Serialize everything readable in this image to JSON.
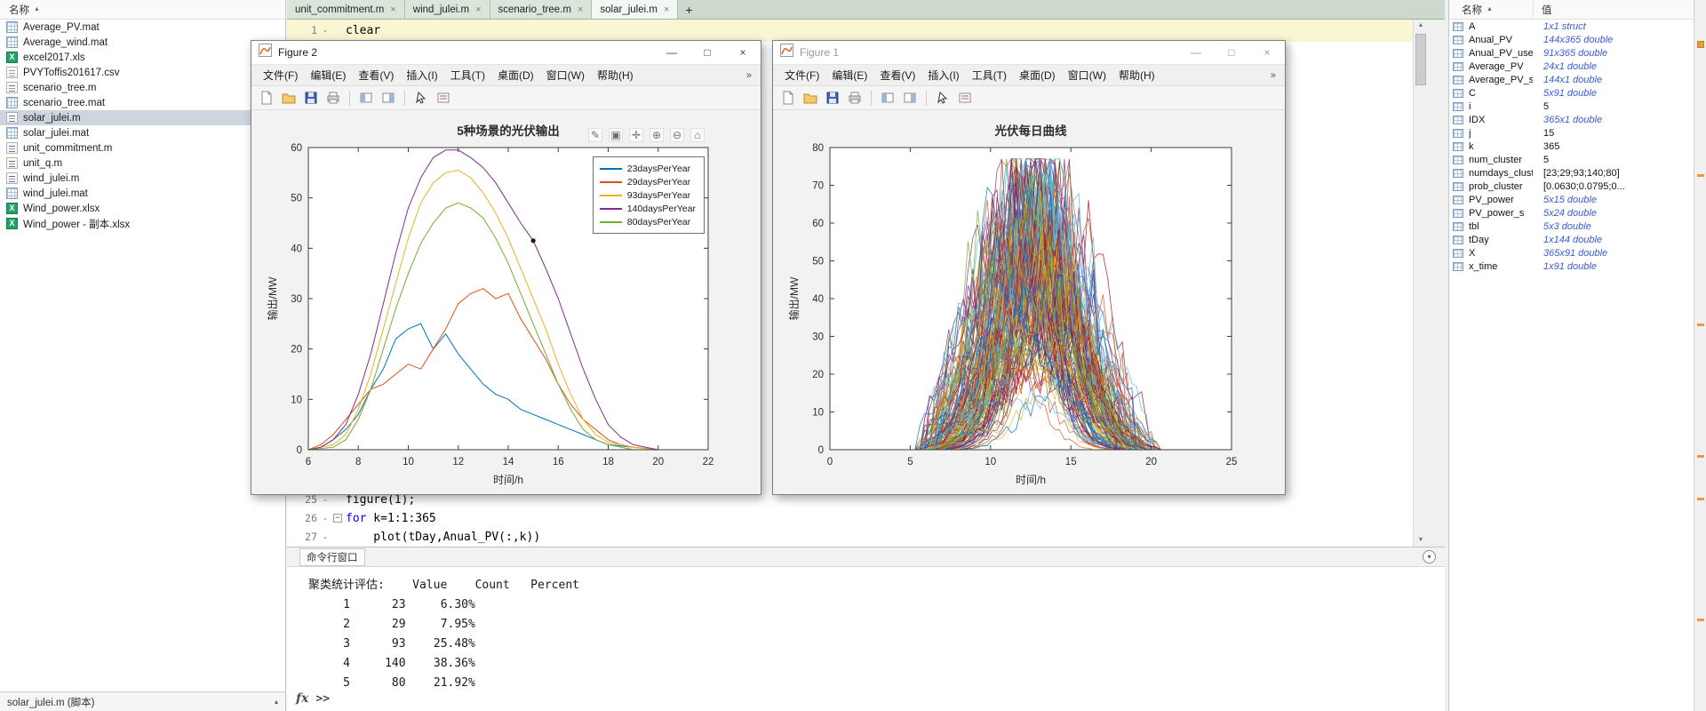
{
  "app": {
    "file_panel": {
      "header": "名称",
      "sort_arrow": "▲",
      "files": [
        {
          "name": "Average_PV.mat",
          "type": "mat",
          "selected": false
        },
        {
          "name": "Average_wind.mat",
          "type": "mat",
          "selected": false
        },
        {
          "name": "excel2017.xls",
          "type": "xls",
          "selected": false
        },
        {
          "name": "PVYToffis201617.csv",
          "type": "csv",
          "selected": false
        },
        {
          "name": "scenario_tree.m",
          "type": "m",
          "selected": false
        },
        {
          "name": "scenario_tree.mat",
          "type": "mat",
          "selected": false
        },
        {
          "name": "solar_julei.m",
          "type": "m",
          "selected": true
        },
        {
          "name": "solar_julei.mat",
          "type": "mat",
          "selected": false
        },
        {
          "name": "unit_commitment.m",
          "type": "m",
          "selected": false
        },
        {
          "name": "unit_q.m",
          "type": "m",
          "selected": false
        },
        {
          "name": "wind_julei.m",
          "type": "m",
          "selected": false
        },
        {
          "name": "wind_julei.mat",
          "type": "mat",
          "selected": false
        },
        {
          "name": "Wind_power.xlsx",
          "type": "xlsx",
          "selected": false
        },
        {
          "name": "Wind_power - 副本.xlsx",
          "type": "xlsx",
          "selected": false
        }
      ],
      "detail_label": "solar_julei.m (脚本)"
    },
    "editor": {
      "tabs": [
        {
          "label": "unit_commitment.m",
          "active": false
        },
        {
          "label": "wind_julei.m",
          "active": false
        },
        {
          "label": "scenario_tree.m",
          "active": false
        },
        {
          "label": "solar_julei.m",
          "active": true
        }
      ],
      "new_tab": "+",
      "lines_top": [
        {
          "num": "1",
          "marker": "-",
          "text": "clear"
        }
      ],
      "lines_bottom": [
        {
          "num": "25",
          "marker": "-",
          "text": "figure(1);"
        },
        {
          "num": "26",
          "marker": "-",
          "keyword": "for",
          "text": " k=1:1:365"
        },
        {
          "num": "27",
          "marker": "-",
          "text": "    plot(tDay,Anual_PV(:,k))"
        }
      ]
    },
    "command_window": {
      "title": "命令行窗口",
      "table": {
        "label": "聚类统计评估:",
        "headers": [
          "Value",
          "Count",
          "Percent"
        ],
        "rows": [
          [
            "1",
            "23",
            "6.30%"
          ],
          [
            "2",
            "29",
            "7.95%"
          ],
          [
            "3",
            "93",
            "25.48%"
          ],
          [
            "4",
            "140",
            "38.36%"
          ],
          [
            "5",
            "80",
            "21.92%"
          ]
        ]
      },
      "prompt_fx": "fx",
      "prompt": ">>"
    },
    "workspace": {
      "name_header": "名称",
      "sort_arrow": "▲",
      "value_header": "值",
      "vars": [
        {
          "name": "A",
          "value": "1x1 struct",
          "kind": "dim"
        },
        {
          "name": "Anual_PV",
          "value": "144x365 double",
          "kind": "dim"
        },
        {
          "name": "Anual_PV_useful",
          "value": "91x365 double",
          "kind": "dim"
        },
        {
          "name": "Average_PV",
          "value": "24x1 double",
          "kind": "dim"
        },
        {
          "name": "Average_PV_s",
          "value": "144x1 double",
          "kind": "dim"
        },
        {
          "name": "C",
          "value": "5x91 double",
          "kind": "dim"
        },
        {
          "name": "i",
          "value": "5",
          "kind": "num"
        },
        {
          "name": "IDX",
          "value": "365x1 double",
          "kind": "dim"
        },
        {
          "name": "j",
          "value": "15",
          "kind": "num"
        },
        {
          "name": "k",
          "value": "365",
          "kind": "num"
        },
        {
          "name": "num_cluster",
          "value": "5",
          "kind": "num"
        },
        {
          "name": "numdays_clust...",
          "value": "[23;29;93;140;80]",
          "kind": "num"
        },
        {
          "name": "prob_cluster",
          "value": "[0.0630;0.0795;0...",
          "kind": "num"
        },
        {
          "name": "PV_power",
          "value": "5x15 double",
          "kind": "dim"
        },
        {
          "name": "PV_power_s",
          "value": "5x24 double",
          "kind": "dim"
        },
        {
          "name": "tbl",
          "value": "5x3 double",
          "kind": "dim"
        },
        {
          "name": "tDay",
          "value": "1x144 double",
          "kind": "dim"
        },
        {
          "name": "X",
          "value": "365x91 double",
          "kind": "dim"
        },
        {
          "name": "x_time",
          "value": "1x91 double",
          "kind": "dim"
        }
      ]
    },
    "figure_windows": [
      {
        "title": "Figure 2",
        "active": true,
        "menu": [
          "文件(F)",
          "编辑(E)",
          "查看(V)",
          "插入(I)",
          "工具(T)",
          "桌面(D)",
          "窗口(W)",
          "帮助(H)"
        ],
        "window_buttons": [
          "—",
          "□",
          "×"
        ]
      },
      {
        "title": "Figure 1",
        "active": false,
        "menu": [
          "文件(F)",
          "编辑(E)",
          "查看(V)",
          "插入(I)",
          "工具(T)",
          "桌面(D)",
          "窗口(W)",
          "帮助(H)"
        ],
        "window_buttons": [
          "—",
          "□",
          "×"
        ]
      }
    ]
  },
  "chart_data": [
    {
      "figure": "Figure 2",
      "type": "line",
      "title": "5种场景的光伏输出",
      "xlabel": "时间/h",
      "ylabel": "输出/MW",
      "xlim": [
        6,
        22
      ],
      "ylim": [
        0,
        60
      ],
      "xticks": [
        6,
        8,
        10,
        12,
        14,
        16,
        18,
        20,
        22
      ],
      "yticks": [
        0,
        10,
        20,
        30,
        40,
        50,
        60
      ],
      "grid": false,
      "legend_position": "northeast",
      "marker_point": {
        "x": 15,
        "y": 41.5
      },
      "series": [
        {
          "name": "23daysPerYear",
          "color": "#0072BD",
          "points": [
            [
              6,
              0
            ],
            [
              6.5,
              0.5
            ],
            [
              7,
              2
            ],
            [
              7.5,
              4
            ],
            [
              8,
              7
            ],
            [
              8.5,
              12
            ],
            [
              9,
              16
            ],
            [
              9.5,
              22
            ],
            [
              10,
              24
            ],
            [
              10.5,
              25
            ],
            [
              11,
              20
            ],
            [
              11.5,
              23
            ],
            [
              12,
              19
            ],
            [
              12.5,
              16
            ],
            [
              13,
              13
            ],
            [
              13.5,
              11
            ],
            [
              14,
              10
            ],
            [
              14.5,
              8
            ],
            [
              15,
              7
            ],
            [
              15.5,
              6
            ],
            [
              16,
              5
            ],
            [
              16.5,
              4
            ],
            [
              17,
              3
            ],
            [
              17.5,
              2
            ],
            [
              18,
              1
            ],
            [
              19,
              0.5
            ],
            [
              20,
              0
            ],
            [
              22,
              0
            ]
          ]
        },
        {
          "name": "29daysPerYear",
          "color": "#D95319",
          "points": [
            [
              6,
              0
            ],
            [
              6.5,
              1
            ],
            [
              7,
              3
            ],
            [
              7.5,
              6
            ],
            [
              8,
              9
            ],
            [
              8.5,
              12
            ],
            [
              9,
              13
            ],
            [
              9.5,
              15
            ],
            [
              10,
              17
            ],
            [
              10.5,
              16
            ],
            [
              11,
              20
            ],
            [
              11.5,
              24
            ],
            [
              12,
              29
            ],
            [
              12.5,
              31
            ],
            [
              13,
              32
            ],
            [
              13.5,
              30
            ],
            [
              14,
              31
            ],
            [
              14.5,
              26
            ],
            [
              15,
              22
            ],
            [
              15.5,
              18
            ],
            [
              16,
              13
            ],
            [
              16.5,
              9
            ],
            [
              17,
              6
            ],
            [
              17.5,
              4
            ],
            [
              18,
              2
            ],
            [
              18.5,
              1
            ],
            [
              19,
              0.5
            ],
            [
              20,
              0
            ],
            [
              22,
              0
            ]
          ]
        },
        {
          "name": "93daysPerYear",
          "color": "#EDB120",
          "points": [
            [
              6,
              0
            ],
            [
              7,
              1
            ],
            [
              7.5,
              3
            ],
            [
              8,
              8
            ],
            [
              8.5,
              15
            ],
            [
              9,
              24
            ],
            [
              9.5,
              33
            ],
            [
              10,
              42
            ],
            [
              10.5,
              49
            ],
            [
              11,
              53
            ],
            [
              11.5,
              55
            ],
            [
              12,
              55.5
            ],
            [
              12.5,
              54
            ],
            [
              13,
              51
            ],
            [
              13.5,
              47
            ],
            [
              14,
              42
            ],
            [
              14.5,
              36
            ],
            [
              15,
              30
            ],
            [
              15.5,
              24
            ],
            [
              16,
              17
            ],
            [
              16.5,
              11
            ],
            [
              17,
              6
            ],
            [
              17.5,
              3
            ],
            [
              18,
              1.5
            ],
            [
              19,
              0.5
            ],
            [
              20,
              0
            ],
            [
              22,
              0
            ]
          ]
        },
        {
          "name": "140daysPerYear",
          "color": "#7E2F8E",
          "points": [
            [
              6,
              0
            ],
            [
              6.5,
              0.5
            ],
            [
              7,
              2
            ],
            [
              7.5,
              5
            ],
            [
              8,
              11
            ],
            [
              8.5,
              19
            ],
            [
              9,
              29
            ],
            [
              9.5,
              39
            ],
            [
              10,
              48
            ],
            [
              10.5,
              54
            ],
            [
              11,
              58
            ],
            [
              11.5,
              59.5
            ],
            [
              12,
              59.5
            ],
            [
              12.5,
              58
            ],
            [
              13,
              56
            ],
            [
              13.5,
              53
            ],
            [
              14,
              49
            ],
            [
              14.5,
              45
            ],
            [
              15,
              41.5
            ],
            [
              15.5,
              36
            ],
            [
              16,
              30
            ],
            [
              16.5,
              23
            ],
            [
              17,
              16
            ],
            [
              17.5,
              10
            ],
            [
              18,
              5
            ],
            [
              18.5,
              2.5
            ],
            [
              19,
              1
            ],
            [
              19.5,
              0.5
            ],
            [
              20,
              0
            ],
            [
              22,
              0
            ]
          ]
        },
        {
          "name": "80daysPerYear",
          "color": "#77AC30",
          "points": [
            [
              6,
              0
            ],
            [
              7,
              0.5
            ],
            [
              7.5,
              2
            ],
            [
              8,
              6
            ],
            [
              8.5,
              12
            ],
            [
              9,
              20
            ],
            [
              9.5,
              28
            ],
            [
              10,
              35
            ],
            [
              10.5,
              41
            ],
            [
              11,
              45
            ],
            [
              11.5,
              48
            ],
            [
              12,
              49
            ],
            [
              12.5,
              48
            ],
            [
              13,
              46
            ],
            [
              13.5,
              42
            ],
            [
              14,
              37
            ],
            [
              14.5,
              31
            ],
            [
              15,
              25
            ],
            [
              15.5,
              19
            ],
            [
              16,
              13
            ],
            [
              16.5,
              8
            ],
            [
              17,
              4
            ],
            [
              17.5,
              2
            ],
            [
              18,
              1
            ],
            [
              19,
              0
            ],
            [
              22,
              0
            ]
          ]
        }
      ]
    },
    {
      "figure": "Figure 1",
      "type": "line",
      "title": "光伏每日曲线",
      "xlabel": "时间/h",
      "ylabel": "输出/MW",
      "xlim": [
        0,
        25
      ],
      "ylim": [
        0,
        80
      ],
      "xticks": [
        0,
        5,
        10,
        15,
        20,
        25
      ],
      "yticks": [
        0,
        10,
        20,
        30,
        40,
        50,
        60,
        70,
        80
      ],
      "grid": false,
      "description": "365 overlaid daily PV output curves, bell-shaped between about 5h and 20h, peaks up to about 70 MW",
      "n_curves": 365,
      "peak_range": [
        8,
        72
      ],
      "daylight_range": [
        5,
        20
      ],
      "palette": [
        "#0072BD",
        "#D95319",
        "#EDB120",
        "#7E2F8E",
        "#77AC30",
        "#4DBEEE",
        "#A2142F"
      ]
    }
  ]
}
